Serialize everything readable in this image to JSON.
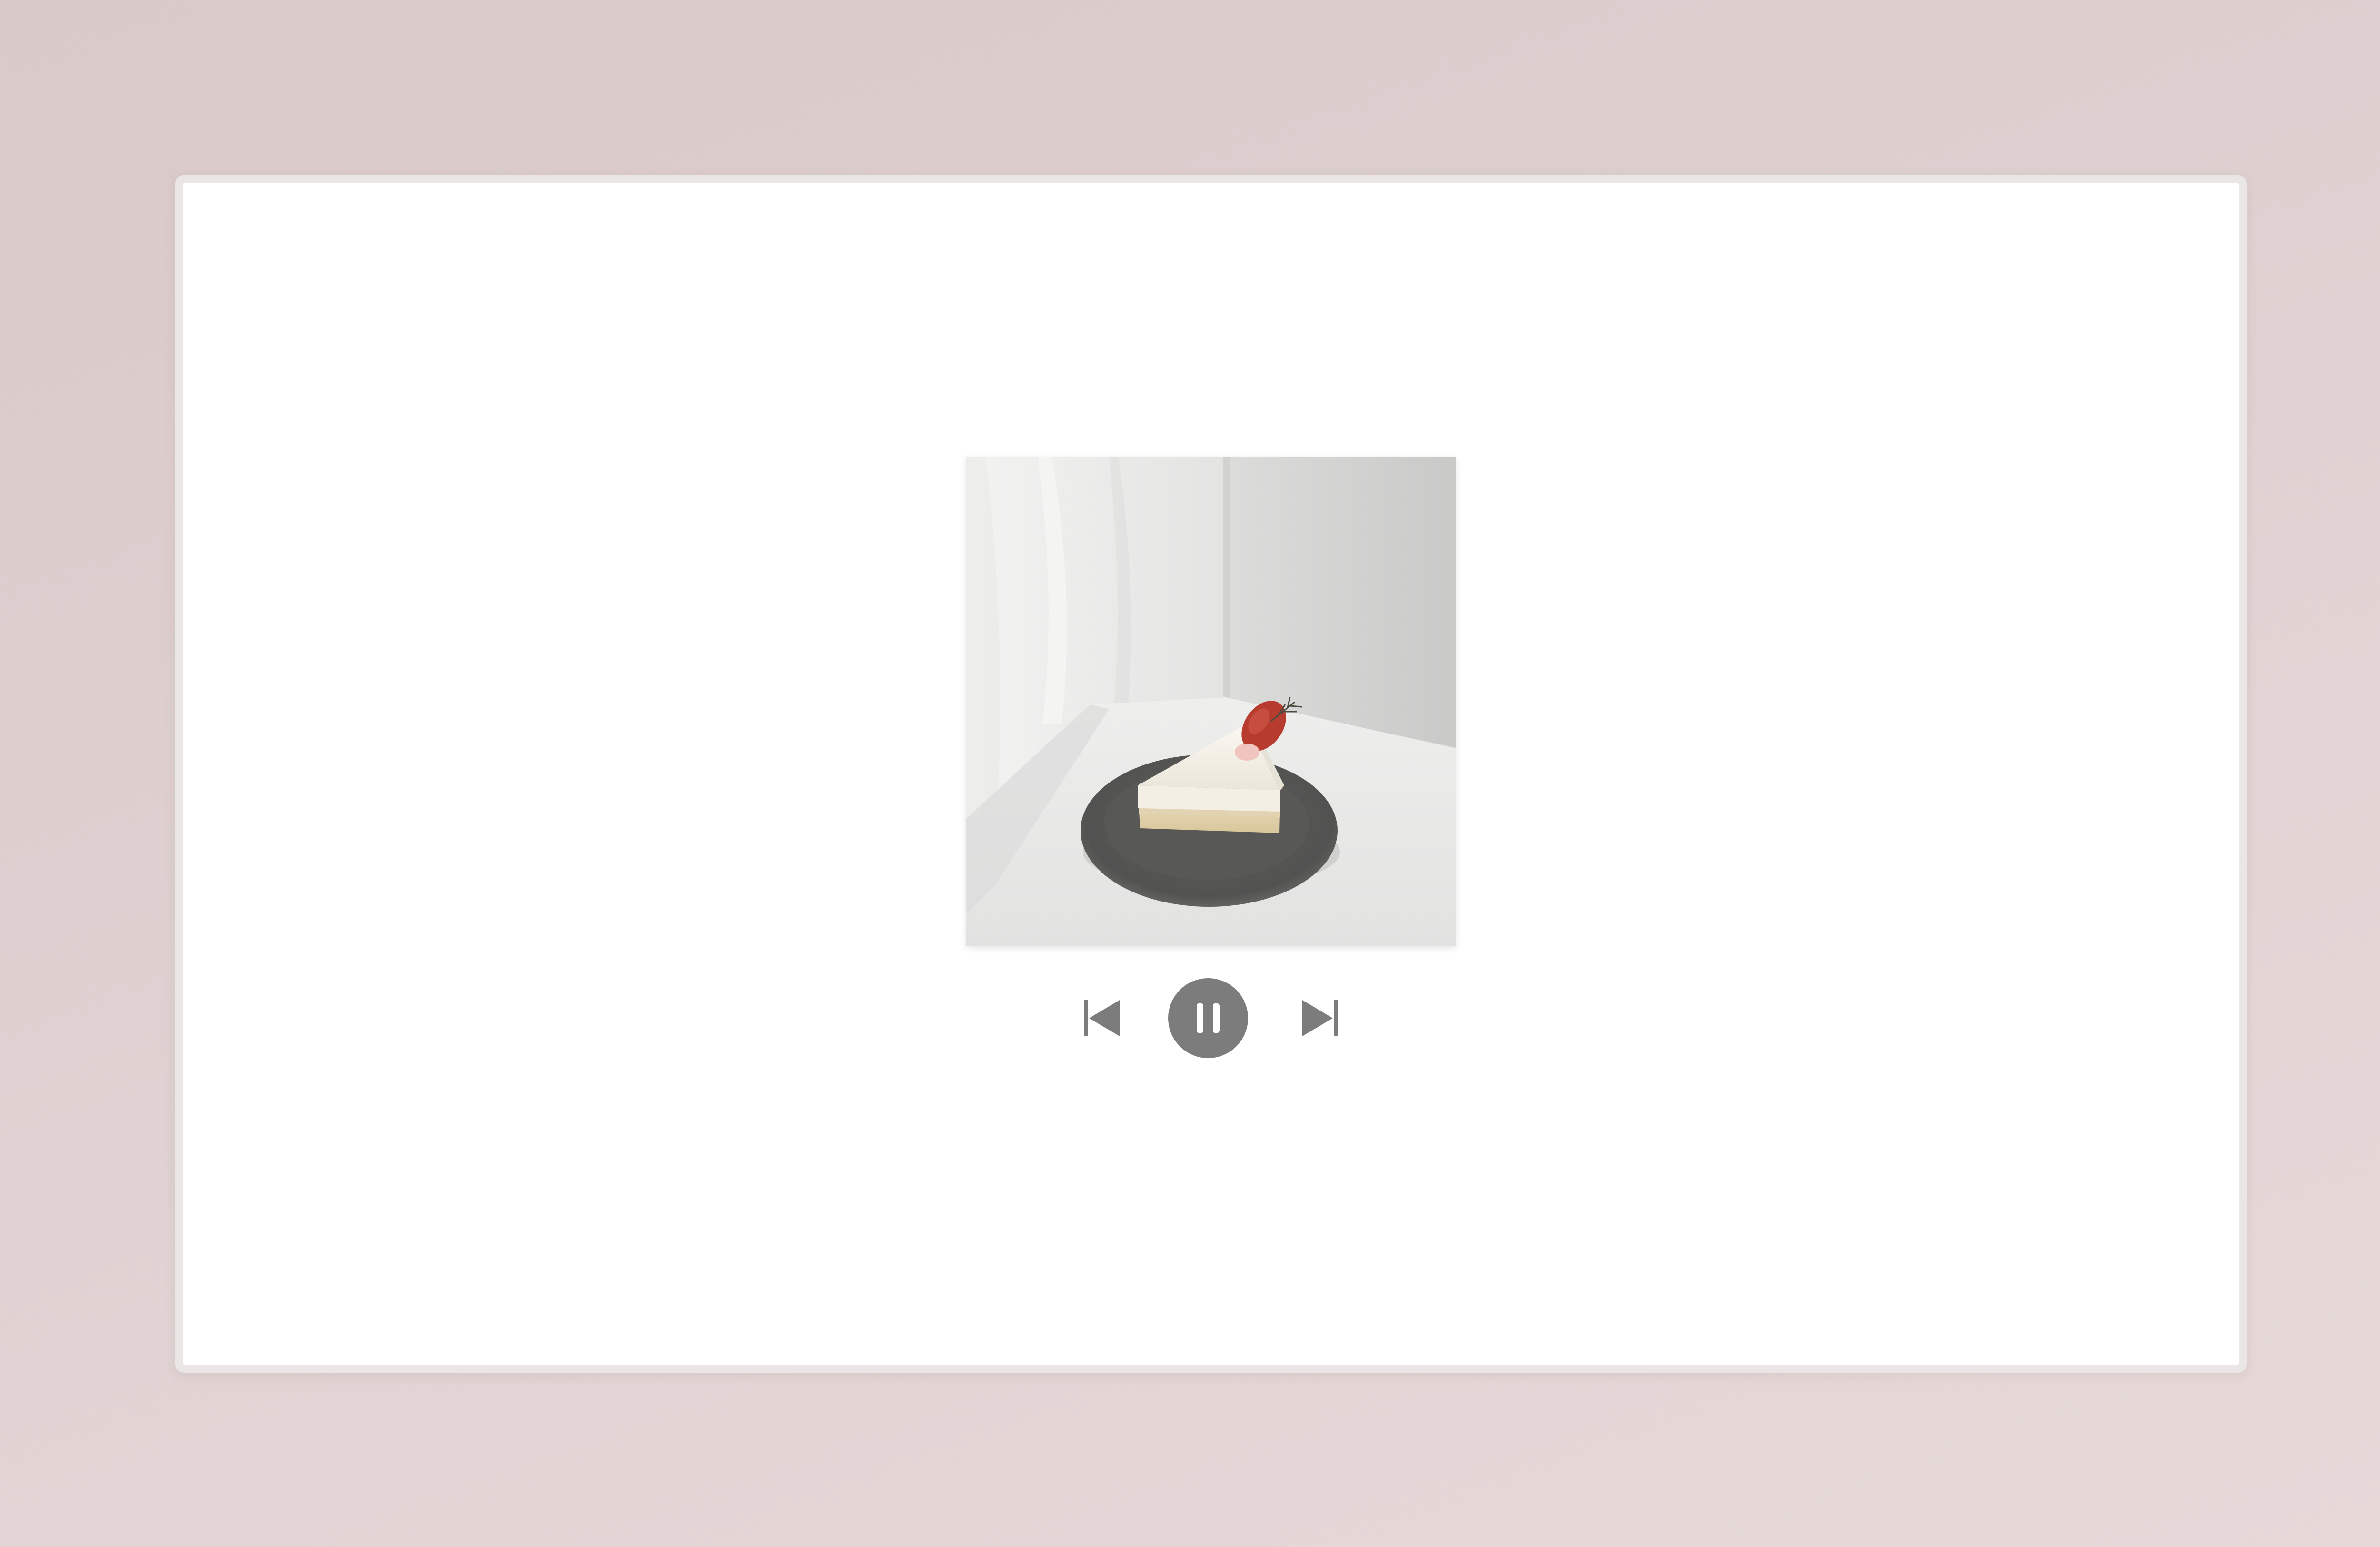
{
  "player": {
    "artwork_icon": "cake-slice-artwork",
    "controls": {
      "prev_icon": "skip-previous-icon",
      "play_pause_icon": "pause-icon",
      "next_icon": "skip-next-icon",
      "state": "playing"
    }
  },
  "colors": {
    "background": "#dccccc",
    "window_border": "#ebe6e6",
    "panel": "#ffffff",
    "control": "#7c7c7c"
  }
}
